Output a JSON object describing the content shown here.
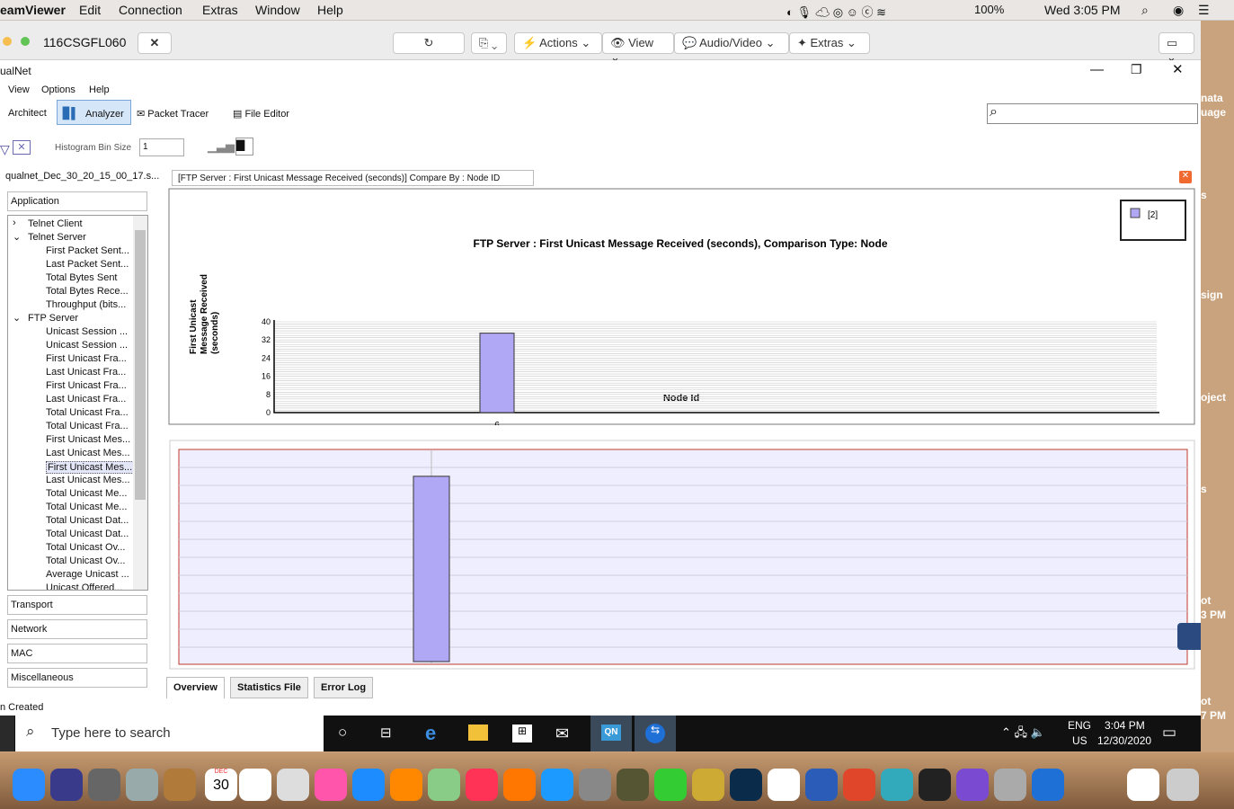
{
  "macbar": {
    "app": "eamViewer",
    "menus": [
      "Edit",
      "Connection",
      "Extras",
      "Window",
      "Help"
    ],
    "battery": "100%",
    "clock": "Wed 3:05 PM"
  },
  "teamviewer": {
    "session_id": "116CSGFL060",
    "actions": "Actions",
    "view": "View",
    "audio_video": "Audio/Video",
    "extras": "Extras"
  },
  "app": {
    "title": "ualNet",
    "menus": [
      "View",
      "Options",
      "Help"
    ],
    "modes": {
      "architect": "Architect",
      "analyzer": "Analyzer",
      "packet_tracer": "Packet Tracer",
      "file_editor": "File Editor"
    },
    "histogram_label": "Histogram Bin Size",
    "histogram_value": "1",
    "file": "qualnet_Dec_30_20_15_00_17.s...",
    "status": "n Created"
  },
  "sidebar": {
    "application": "Application",
    "transport": "Transport",
    "network": "Network",
    "mac": "MAC",
    "misc": "Miscellaneous",
    "items": [
      "Telnet Client",
      "Telnet Server",
      "First Packet Sent...",
      "Last Packet Sent...",
      "Total Bytes Sent",
      "Total Bytes Rece...",
      "Throughput (bits...",
      "FTP Server",
      "Unicast Session ...",
      "Unicast Session ...",
      "First Unicast Fra...",
      "Last Unicast Fra...",
      "First Unicast Fra...",
      "Last Unicast Fra...",
      "Total Unicast Fra...",
      "Total Unicast Fra...",
      "First Unicast Mes...",
      "Last Unicast Mes...",
      "First Unicast Mes...",
      "Last Unicast Mes...",
      "Total Unicast Me...",
      "Total Unicast Me...",
      "Total Unicast Dat...",
      "Total Unicast Dat...",
      "Total Unicast Ov...",
      "Total Unicast Ov...",
      "Average Unicast ...",
      "Unicast Offered..."
    ]
  },
  "chart_tab": "[FTP Server :  First Unicast Message Received (seconds)] Compare By : Node ID",
  "chart_data": {
    "type": "bar",
    "title": "FTP Server :  First Unicast Message Received (seconds), Comparison Type: Node",
    "xlabel": "Node Id",
    "ylabel": "First Unicast Message Received (seconds)",
    "categories": [
      "6"
    ],
    "series": [
      {
        "name": "[2]",
        "values": [
          35
        ]
      }
    ],
    "ylim": [
      0,
      40
    ],
    "yticks": [
      "40",
      "32",
      "24",
      "16",
      "8",
      "0"
    ],
    "legend": "top-right",
    "color": "#b0a8f4"
  },
  "bottom_tabs": [
    "Overview",
    "Statistics File",
    "Error Log"
  ],
  "taskbar": {
    "search_placeholder": "Type here to search",
    "lang1": "ENG",
    "lang2": "US",
    "time": "3:04 PM",
    "date": "12/30/2020"
  },
  "desktop": [
    "nata",
    "uage",
    "s",
    "sign",
    "oject",
    "s",
    "ot",
    "3 PM",
    "ot",
    "7 PM"
  ],
  "dock": {
    "calendar_day": "30",
    "calendar_month": "DEC"
  }
}
